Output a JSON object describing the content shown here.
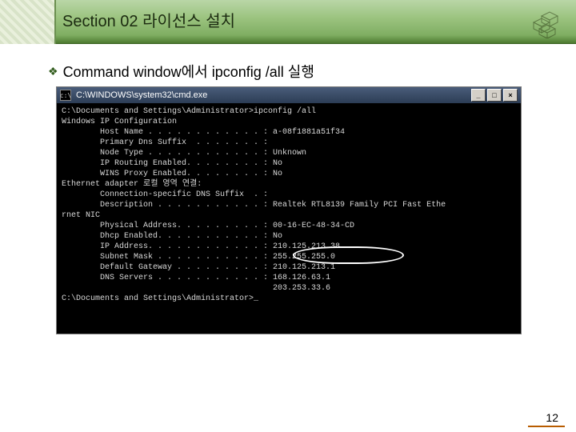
{
  "header": {
    "section_title": "Section 02 라이선스 설치"
  },
  "bullet": {
    "marker": "❖",
    "text": "Command window에서 ipconfig /all 실행"
  },
  "cmd": {
    "icon_glyph": "c:\\",
    "title": "C:\\WINDOWS\\system32\\cmd.exe",
    "buttons": {
      "min": "_",
      "max": "□",
      "close": "×"
    },
    "lines": [
      "",
      "C:\\Documents and Settings\\Administrator>ipconfig /all",
      "",
      "Windows IP Configuration",
      "",
      "        Host Name . . . . . . . . . . . . : a-08f1881a51f34",
      "        Primary Dns Suffix  . . . . . . . :",
      "        Node Type . . . . . . . . . . . . : Unknown",
      "        IP Routing Enabled. . . . . . . . : No",
      "        WINS Proxy Enabled. . . . . . . . : No",
      "",
      "Ethernet adapter 로컬 영역 연결:",
      "",
      "        Connection-specific DNS Suffix  . :",
      "        Description . . . . . . . . . . . : Realtek RTL8139 Family PCI Fast Ethe",
      "rnet NIC",
      "        Physical Address. . . . . . . . . : 00-16-EC-48-34-CD",
      "        Dhcp Enabled. . . . . . . . . . . : No",
      "        IP Address. . . . . . . . . . . . : 210.125.213.38",
      "        Subnet Mask . . . . . . . . . . . : 255.255.255.0",
      "        Default Gateway . . . . . . . . . : 210.125.213.1",
      "        DNS Servers . . . . . . . . . . . : 168.126.63.1",
      "                                            203.253.33.6",
      "",
      "C:\\Documents and Settings\\Administrator>_"
    ]
  },
  "page_number": "12"
}
